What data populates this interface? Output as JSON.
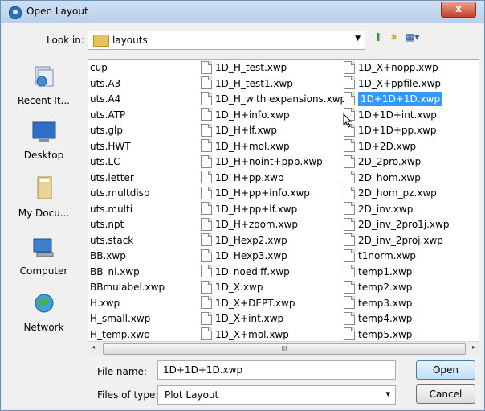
{
  "window": {
    "title": "Open Layout",
    "close_symbol": "x"
  },
  "lookin": {
    "label": "Look in:",
    "value": "layouts"
  },
  "toolbar": {
    "up_symbol": "⬆",
    "newfolder_symbol": "✶",
    "view_symbol": "▦▾"
  },
  "places": [
    {
      "label": "Recent It..."
    },
    {
      "label": "Desktop"
    },
    {
      "label": "My Docu..."
    },
    {
      "label": "Computer"
    },
    {
      "label": "Network"
    }
  ],
  "files": {
    "col1": [
      "cup",
      "uts.A3",
      "uts.A4",
      "uts.ATP",
      "uts.glp",
      "uts.HWT",
      "uts.LC",
      "uts.letter",
      "uts.multdisp",
      "uts.multi",
      "uts.npt",
      "uts.stack",
      "BB.xwp",
      "BB_ni.xwp",
      "BBmulabel.xwp",
      "H.xwp",
      "H_small.xwp",
      "H_temp.xwp"
    ],
    "col2": [
      "1D_H_test.xwp",
      "1D_H_test1.xwp",
      "1D_H_with expansions.xwp",
      "1D_H+info.xwp",
      "1D_H+lf.xwp",
      "1D_H+mol.xwp",
      "1D_H+noint+ppp.xwp",
      "1D_H+pp.xwp",
      "1D_H+pp+info.xwp",
      "1D_H+pp+lf.xwp",
      "1D_H+zoom.xwp",
      "1D_Hexp2.xwp",
      "1D_Hexp3.xwp",
      "1D_noediff.xwp",
      "1D_X.xwp",
      "1D_X+DEPT.xwp",
      "1D_X+int.xwp",
      "1D_X+mol.xwp"
    ],
    "col3": [
      "1D_X+nopp.xwp",
      "1D_X+ppfile.xwp",
      "1D+1D+1D.xwp",
      "1D+1D+int.xwp",
      "1D+1D+pp.xwp",
      "1D+2D.xwp",
      "2D_2pro.xwp",
      "2D_hom.xwp",
      "2D_hom_pz.xwp",
      "2D_inv.xwp",
      "2D_inv_2pro1j.xwp",
      "2D_inv_2proj.xwp",
      "t1norm.xwp",
      "temp1.xwp",
      "temp2.xwp",
      "temp3.xwp",
      "temp4.xwp",
      "temp5.xwp"
    ]
  },
  "scroll": {
    "left_arrow": "◂",
    "right_arrow": "▸",
    "thumb_grip": "III"
  },
  "filename": {
    "label": "File name:",
    "value": "1D+1D+1D.xwp"
  },
  "filetype": {
    "label": "Files of type:",
    "value": "Plot Layout",
    "arrow": "▾"
  },
  "buttons": {
    "open": "Open",
    "cancel": "Cancel"
  },
  "colors": {
    "selection": "#3399ff",
    "titlebar": "#c3d6ee"
  }
}
